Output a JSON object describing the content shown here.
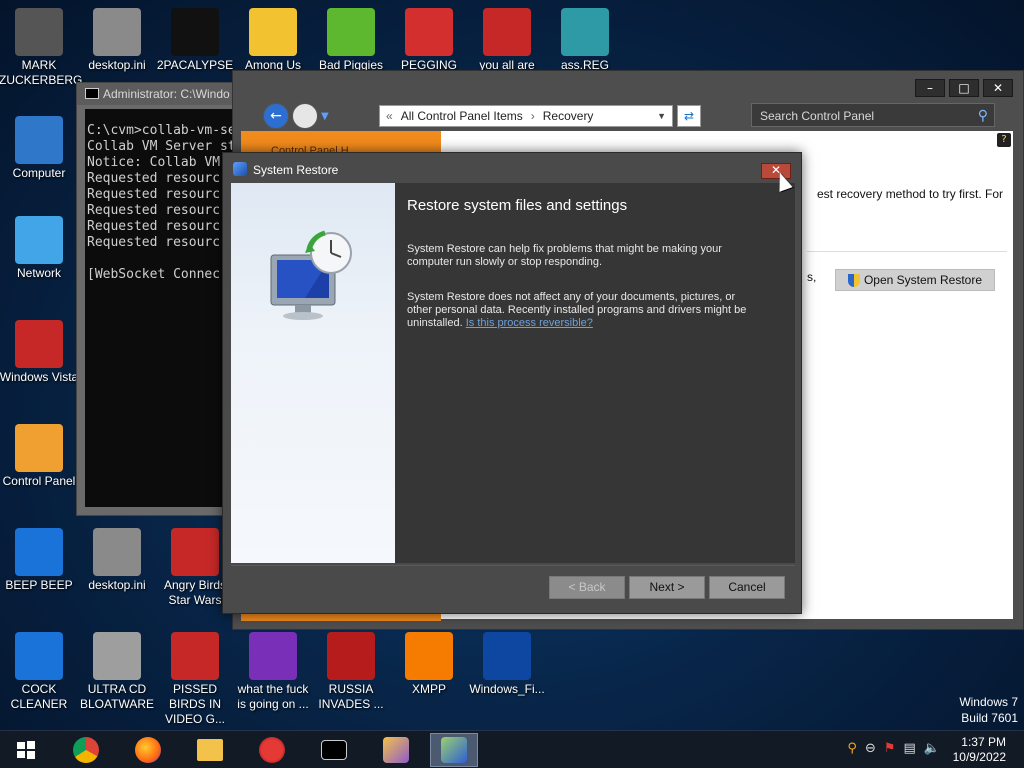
{
  "desktop_icons": [
    {
      "label": "MARK ZUCKERBERG",
      "icon": "person-figure-icon",
      "color": "#555555"
    },
    {
      "label": "desktop.ini",
      "icon": "settings-file-icon",
      "color": "#8a8a8a"
    },
    {
      "label": "2PACALYPSE",
      "icon": "cmd-window-icon",
      "color": "#111111"
    },
    {
      "label": "Among Us",
      "icon": "folder-doc-icon",
      "color": "#f2c230"
    },
    {
      "label": "Bad Piggies",
      "icon": "green-pig-icon",
      "color": "#5eb82f"
    },
    {
      "label": "PEGGING",
      "icon": "letter-p-icon",
      "color": "#d32f2f"
    },
    {
      "label": "you all are",
      "icon": "dev-cpp-icon",
      "color": "#c62828"
    },
    {
      "label": "ass.REG",
      "icon": "registry-cubes-icon",
      "color": "#2e9aa6"
    },
    {
      "label": "Computer",
      "icon": "computer-icon",
      "color": "#2f78c9"
    },
    {
      "label": "Network",
      "icon": "globe-network-icon",
      "color": "#41a5e8"
    },
    {
      "label": "Windows Vista",
      "icon": "recycle-bin-icon",
      "color": "#c62828"
    },
    {
      "label": "Control Panel",
      "icon": "control-panel-icon",
      "color": "#f0a030"
    },
    {
      "label": "BEEP BEEP",
      "icon": "blue-panel-icon",
      "color": "#1a73d9"
    },
    {
      "label": "desktop.ini",
      "icon": "settings-file-icon",
      "color": "#8a8a8a"
    },
    {
      "label": "Angry Birds Star Wars",
      "icon": "angry-birds-star-wars-icon",
      "color": "#c62828"
    },
    {
      "label": "COCK CLEANER",
      "icon": "blue-panel-icon",
      "color": "#1a73d9"
    },
    {
      "label": "ULTRA CD BLOATWARE",
      "icon": "cd-disc-icon",
      "color": "#9e9e9e"
    },
    {
      "label": "PISSED BIRDS IN VIDEO G...",
      "icon": "red-bird-icon",
      "color": "#c62828"
    },
    {
      "label": "what the fuck is going on ...",
      "icon": "angry-birds-space-icon",
      "color": "#7a2fb8"
    },
    {
      "label": "RUSSIA INVADES ...",
      "icon": "radiation-icon",
      "color": "#b71c1c"
    },
    {
      "label": "XMPP",
      "icon": "xampp-icon",
      "color": "#f57c00"
    },
    {
      "label": "Windows_Fi...",
      "icon": "windows-screen-icon",
      "color": "#0d47a1"
    }
  ],
  "console": {
    "title": "Administrator: C:\\Windo",
    "lines": "C:\\cvm>collab-vm-se\nCollab VM Server st\nNotice: Collab VM\nRequested resourc\nRequested resourc\nRequested resourc\nRequested resourc\nRequested resourc\n\n[WebSocket Connec"
  },
  "control_panel": {
    "breadcrumb_sep": "«",
    "breadcrumb": [
      "All Control Panel Items",
      "Recovery"
    ],
    "breadcrumb_arrow": "›",
    "search_placeholder": "Search Control Panel",
    "content_text": "est recovery method to try first. For",
    "side_fragment": "s,",
    "open_system_restore": "Open System Restore",
    "sidebar_heading": "Control Panel H"
  },
  "system_restore": {
    "title": "System Restore",
    "heading": "Restore system files and settings",
    "p1": "System Restore can help fix problems that might be making your computer run slowly or stop responding.",
    "p2": "System Restore does not affect any of your documents, pictures, or other personal data. Recently installed programs and drivers might be uninstalled.",
    "link": "Is this process reversible?",
    "back": "< Back",
    "next": "Next >",
    "cancel": "Cancel",
    "close": "✕"
  },
  "taskbar": {
    "items": [
      "start-windows-icon",
      "chrome-icon",
      "firefox-icon",
      "file-explorer-icon",
      "angry-birds-icon",
      "cmd-icon",
      "control-panel-icon",
      "system-restore-icon"
    ],
    "time": "1:37 PM",
    "date": "10/9/2022"
  },
  "watermark": {
    "line1": "Windows 7",
    "line2": "Build 7601"
  },
  "colors": {
    "accent_orange": "#f28b1d",
    "close_red": "#b94a3a",
    "link_blue": "#6fa0d8"
  }
}
